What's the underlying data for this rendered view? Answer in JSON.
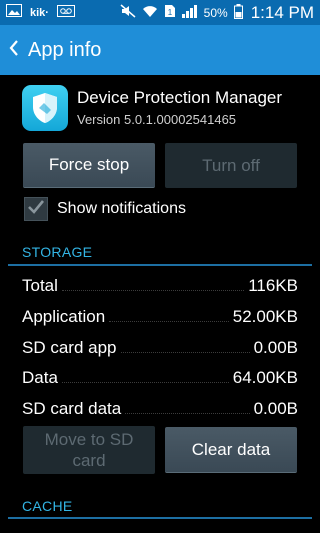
{
  "status_bar": {
    "kik_label": "kik·",
    "battery_pct": "50%",
    "time": "1:14 PM"
  },
  "action_bar": {
    "title": "App info"
  },
  "app": {
    "name": "Device Protection Manager",
    "version": "Version 5.0.1.00002541465"
  },
  "buttons": {
    "force_stop": "Force stop",
    "turn_off": "Turn off",
    "move_to_sd": "Move to SD card",
    "clear_data": "Clear data"
  },
  "notifications": {
    "label": "Show notifications",
    "checked": true
  },
  "storage": {
    "header": "STORAGE",
    "rows": [
      {
        "label": "Total",
        "value": "116KB"
      },
      {
        "label": "Application",
        "value": "52.00KB"
      },
      {
        "label": "SD card app",
        "value": "0.00B"
      },
      {
        "label": "Data",
        "value": "64.00KB"
      },
      {
        "label": "SD card data",
        "value": "0.00B"
      }
    ]
  },
  "cache": {
    "header": "CACHE"
  },
  "colors": {
    "status_bar": "#0a6bb0",
    "action_bar": "#1f8ed8",
    "accent": "#33b5e5"
  }
}
